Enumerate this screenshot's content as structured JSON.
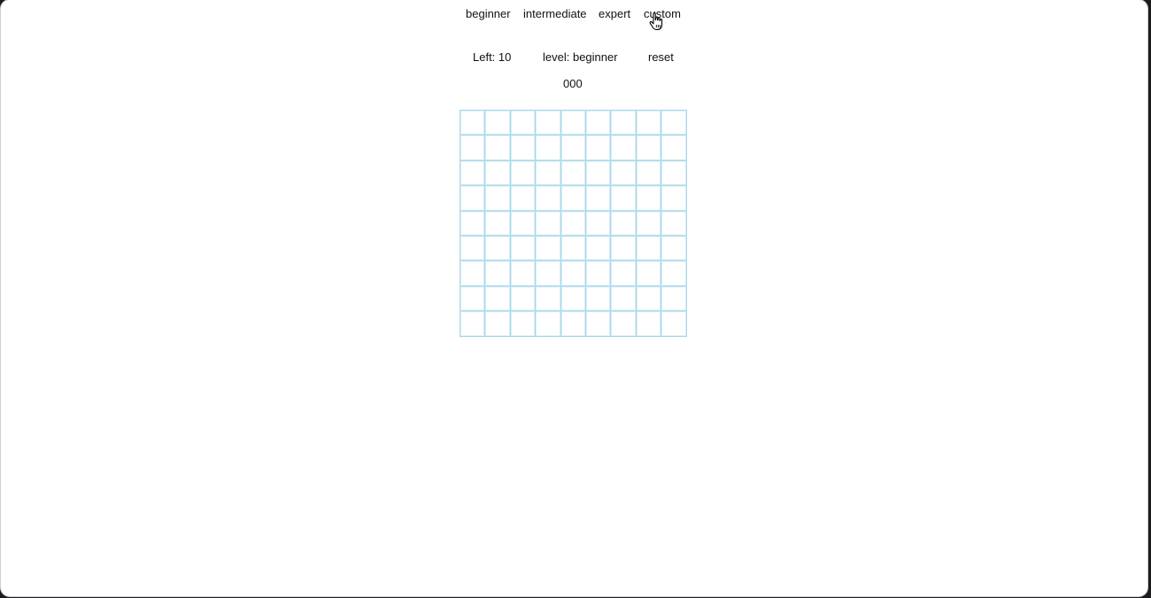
{
  "levels": {
    "beginner": "beginner",
    "intermediate": "intermediate",
    "expert": "expert",
    "custom": "custom"
  },
  "status": {
    "left": "Left: 10",
    "level": "level: beginner",
    "reset": "reset"
  },
  "timer": "000",
  "board": {
    "rows": 9,
    "cols": 9,
    "grid_color": "#a9d8ea"
  },
  "cursor_icon": "hand-pointer-icon"
}
